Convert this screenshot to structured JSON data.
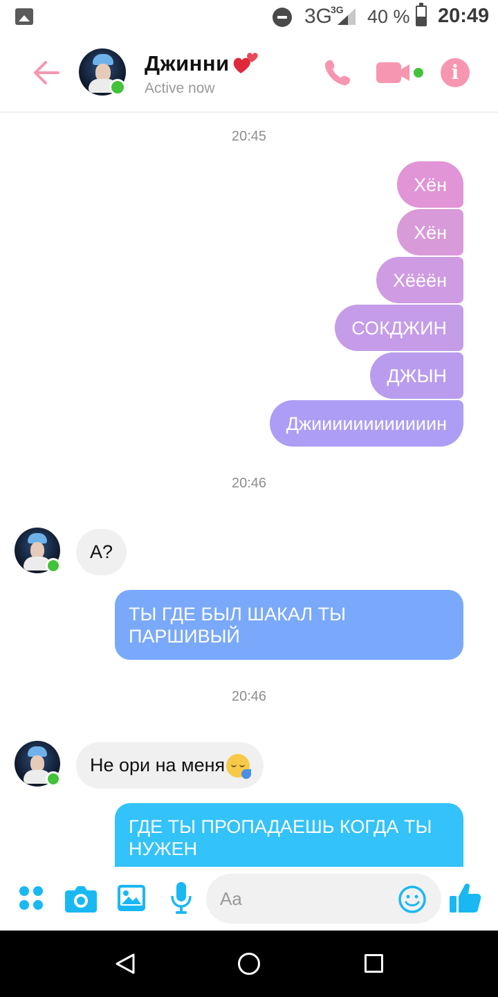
{
  "status_bar": {
    "network": "3G",
    "network_sup": "3G",
    "battery": "40 %",
    "time": "20:49"
  },
  "header": {
    "contact_name": "Джинни",
    "status": "Active now",
    "accent_color": "#f796b0"
  },
  "messages": {
    "timestamp_1": "20:45",
    "outgoing_group_1": [
      "Хён",
      "Хён",
      "Хёёён",
      "СОКДЖИН",
      "ДЖЫН",
      "Джиииииииииииин"
    ],
    "timestamp_2": "20:46",
    "incoming_1": "А?",
    "outgoing_2": "ТЫ ГДЕ БЫЛ ШАКАЛ ТЫ ПАРШИВЫЙ",
    "timestamp_3": "20:46",
    "incoming_2": "Не ори на меня",
    "outgoing_3": "ГДЕ ТЫ ПРОПАДАЕШЬ КОГДА ТЫ НУЖЕН"
  },
  "composer": {
    "placeholder": "Aa",
    "icon_color": "#1ab8f3",
    "icons": [
      "apps-icon",
      "camera-icon",
      "gallery-icon",
      "microphone-icon",
      "emoji-icon",
      "thumbs-up-icon"
    ]
  },
  "navbar": {
    "icons": [
      "nav-back-icon",
      "nav-home-icon",
      "nav-recents-icon"
    ]
  }
}
